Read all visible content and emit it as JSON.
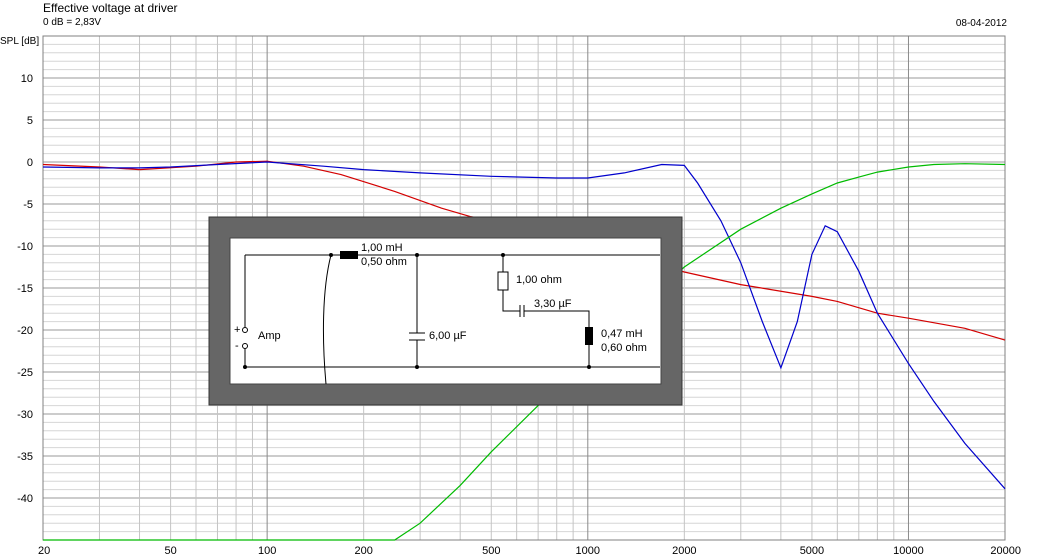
{
  "header": {
    "title": "Effective voltage at driver",
    "subtitle": "0 dB = 2,83V",
    "date": "08-04-2012"
  },
  "chart_data": {
    "type": "line",
    "ylabel": "SPL [dB]",
    "xlabel": "",
    "x_scale": "log",
    "xlim": [
      20,
      20000
    ],
    "ylim": [
      -45,
      15
    ],
    "x_ticks": [
      20,
      50,
      100,
      200,
      500,
      1000,
      2000,
      5000,
      10000,
      20000
    ],
    "x_tick_labels": [
      "20",
      "50",
      "100",
      "200",
      "500",
      "1000",
      "2000",
      "5000",
      "10000",
      "20000"
    ],
    "y_ticks": [
      10,
      5,
      0,
      -5,
      -10,
      -15,
      -20,
      -25,
      -30,
      -35,
      -40
    ],
    "y_tick_labels": [
      "10",
      "5",
      "0",
      "-5",
      "-10",
      "-15",
      "-20",
      "-25",
      "-30",
      "-35",
      "-40"
    ],
    "grid": true,
    "series": [
      {
        "color": "#d40000",
        "x": [
          20,
          30,
          40,
          60,
          80,
          100,
          130,
          170,
          250,
          350,
          430,
          520,
          2000,
          3000,
          5000,
          6000,
          8000,
          10000,
          15000,
          20000
        ],
        "y": [
          -0.3,
          -0.6,
          -0.9,
          -0.5,
          0.0,
          0.1,
          -0.5,
          -1.5,
          -3.5,
          -5.5,
          -6.5,
          -7.0,
          -13.1,
          -14.6,
          -16.0,
          -16.6,
          -18.0,
          -18.6,
          -19.8,
          -21.2
        ]
      },
      {
        "color": "#0000cc",
        "x": [
          20,
          30,
          40,
          50,
          70,
          100,
          150,
          200,
          300,
          500,
          800,
          1000,
          1300,
          1700,
          2000,
          2200,
          2600,
          3000,
          3500,
          4000,
          4500,
          5000,
          5500,
          6000,
          7000,
          8000,
          10000,
          12000,
          15000,
          20000
        ],
        "y": [
          -0.6,
          -0.7,
          -0.7,
          -0.6,
          -0.3,
          0.0,
          -0.5,
          -0.9,
          -1.3,
          -1.7,
          -1.9,
          -1.9,
          -1.3,
          -0.3,
          -0.4,
          -2.5,
          -7.0,
          -12.0,
          -19.0,
          -24.5,
          -19.0,
          -11.0,
          -7.6,
          -8.3,
          -13.0,
          -18.0,
          -24.0,
          -28.5,
          -33.5,
          -38.9
        ]
      },
      {
        "color": "#00bb00",
        "x": [
          20,
          250,
          300,
          400,
          500,
          700,
          900,
          2000,
          3000,
          4000,
          5000,
          6000,
          7000,
          8000,
          10000,
          12000,
          15000,
          20000
        ],
        "y": [
          -45,
          -45,
          -43,
          -38.5,
          -34.5,
          -29.0,
          -24.5,
          -12.5,
          -8.0,
          -5.5,
          -3.8,
          -2.5,
          -1.8,
          -1.2,
          -0.6,
          -0.3,
          -0.2,
          -0.3
        ]
      }
    ]
  },
  "schematic": {
    "inductor1_value": "1,00 mH",
    "inductor1_resistance": "0,50 ohm",
    "capacitor1_value": "6,00 µF",
    "resistor_value": "1,00 ohm",
    "capacitor2_value": "3,30 µF",
    "inductor2_value": "0,47 mH",
    "inductor2_resistance": "0,60 ohm",
    "amp_label": "Amp",
    "plus_sign": "+",
    "minus_sign": "-"
  }
}
